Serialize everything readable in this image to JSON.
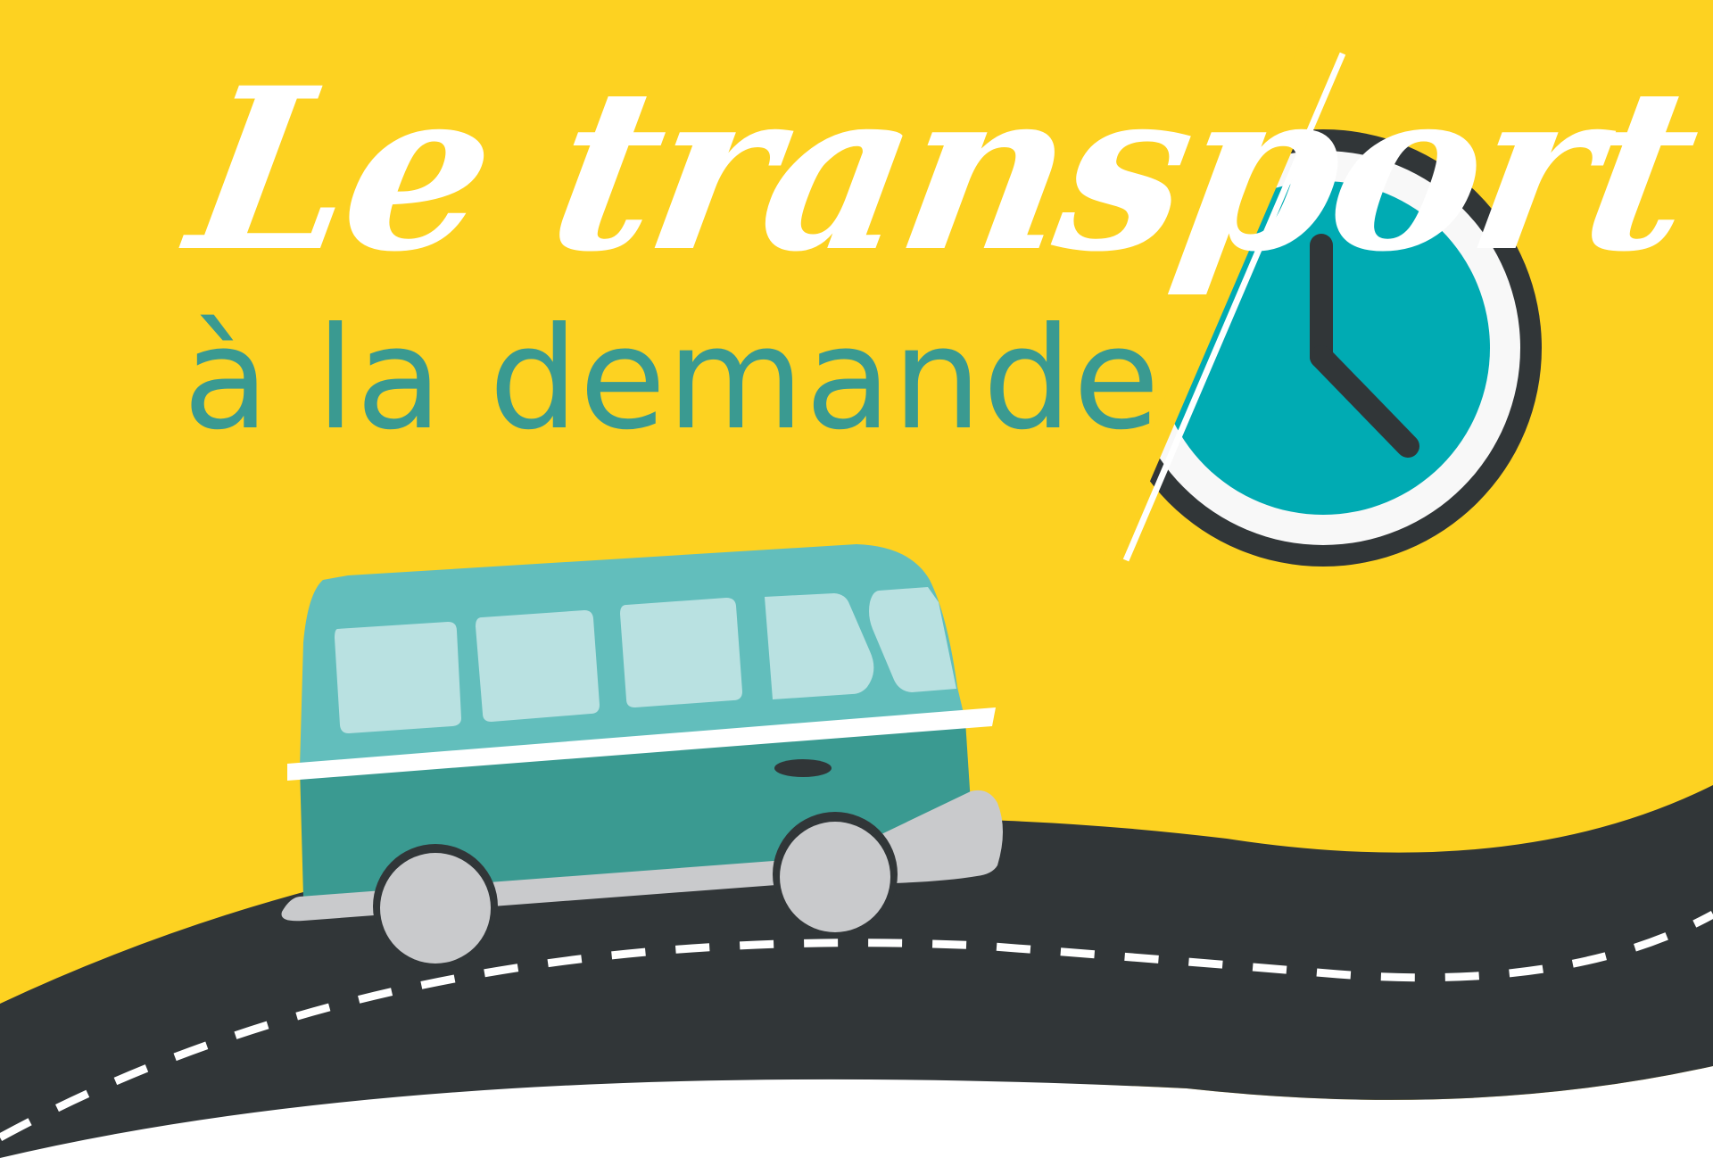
{
  "title": {
    "line1": "Le transport",
    "line2": "à la demande"
  },
  "colors": {
    "background": "#fdd221",
    "road": "#313638",
    "road_markings": "#ffffff",
    "title_script": "#ffffff",
    "title_sans": "#3a9a91",
    "bus_upper": "#62bebc",
    "bus_lower": "#3a9a91",
    "bus_windows": "#b9e1e1",
    "bus_bumper": "#c9cacc",
    "clock_face": "#00abb3",
    "clock_rim": "#f8f8f8",
    "clock_shadow": "#313638",
    "clock_hands": "#313638"
  },
  "icons": {
    "clock": "clock-icon",
    "bus": "minibus-icon",
    "road": "road-illustration"
  }
}
